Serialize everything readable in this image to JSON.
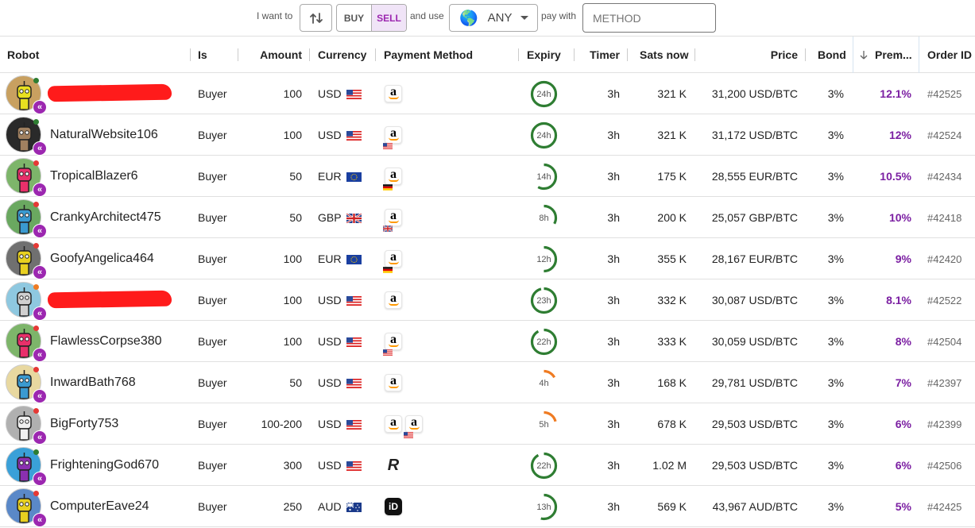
{
  "filter": {
    "i_want_to": "I want to",
    "buy": "BUY",
    "sell": "SELL",
    "and_use": "and use",
    "currency_selected": "ANY",
    "pay_with": "pay with",
    "method_placeholder": "METHOD"
  },
  "columns": {
    "robot": "Robot",
    "is": "Is",
    "amount": "Amount",
    "currency": "Currency",
    "payment_method": "Payment Method",
    "expiry": "Expiry",
    "timer": "Timer",
    "sats_now": "Sats now",
    "price": "Price",
    "bond": "Bond",
    "premium": "Prem...",
    "order_id": "Order ID"
  },
  "sort": {
    "column": "premium",
    "direction": "descending"
  },
  "rows": [
    {
      "nick": "",
      "redacted": true,
      "status": "online",
      "avatar_bg": "#c8a060",
      "avatar_fg": "#e8e020",
      "is": "Buyer",
      "amount": "100",
      "currency": "USD",
      "flag": "us",
      "methods": [
        {
          "icon": "amazon-icon",
          "flag": ""
        }
      ],
      "expiry_label": "24h",
      "expiry_fraction": 1.0,
      "expiry_color": "#2e7d32",
      "timer": "3h",
      "sats": "321 K",
      "price": "31,200 USD/BTC",
      "bond": "3%",
      "premium": "12.1%",
      "order_id": "#42525"
    },
    {
      "nick": "NaturalWebsite106",
      "status": "online",
      "avatar_bg": "#2a2a2a",
      "avatar_fg": "#a08060",
      "is": "Buyer",
      "amount": "100",
      "currency": "USD",
      "flag": "us",
      "methods": [
        {
          "icon": "amazon-icon",
          "flag": "us"
        }
      ],
      "expiry_label": "24h",
      "expiry_fraction": 1.0,
      "expiry_color": "#2e7d32",
      "timer": "3h",
      "sats": "321 K",
      "price": "31,172 USD/BTC",
      "bond": "3%",
      "premium": "12%",
      "order_id": "#42524"
    },
    {
      "nick": "TropicalBlazer6",
      "status": "offline",
      "avatar_bg": "#7db56a",
      "avatar_fg": "#e8306a",
      "is": "Buyer",
      "amount": "50",
      "currency": "EUR",
      "flag": "eu",
      "methods": [
        {
          "icon": "amazon-icon",
          "flag": "de"
        }
      ],
      "expiry_label": "14h",
      "expiry_fraction": 0.58,
      "expiry_color": "#2e7d32",
      "timer": "3h",
      "sats": "175 K",
      "price": "28,555 EUR/BTC",
      "bond": "3%",
      "premium": "10.5%",
      "order_id": "#42434"
    },
    {
      "nick": "CrankyArchitect475",
      "status": "offline",
      "avatar_bg": "#6aa860",
      "avatar_fg": "#3a9ad0",
      "is": "Buyer",
      "amount": "50",
      "currency": "GBP",
      "flag": "gb",
      "methods": [
        {
          "icon": "amazon-icon",
          "flag": "gb"
        }
      ],
      "expiry_label": "8h",
      "expiry_fraction": 0.33,
      "expiry_color": "#2e7d32",
      "timer": "3h",
      "sats": "200 K",
      "price": "25,057 GBP/BTC",
      "bond": "3%",
      "premium": "10%",
      "order_id": "#42418"
    },
    {
      "nick": "GoofyAngelica464",
      "status": "offline",
      "avatar_bg": "#707070",
      "avatar_fg": "#e8d020",
      "is": "Buyer",
      "amount": "100",
      "currency": "EUR",
      "flag": "eu",
      "methods": [
        {
          "icon": "amazon-icon",
          "flag": "de"
        }
      ],
      "expiry_label": "12h",
      "expiry_fraction": 0.5,
      "expiry_color": "#2e7d32",
      "timer": "3h",
      "sats": "355 K",
      "price": "28,167 EUR/BTC",
      "bond": "3%",
      "premium": "9%",
      "order_id": "#42420"
    },
    {
      "nick": "",
      "redacted": true,
      "status": "away",
      "avatar_bg": "#8ec8e0",
      "avatar_fg": "#d0d0d0",
      "is": "Buyer",
      "amount": "100",
      "currency": "USD",
      "flag": "us",
      "methods": [
        {
          "icon": "amazon-icon",
          "flag": ""
        }
      ],
      "expiry_label": "23h",
      "expiry_fraction": 0.96,
      "expiry_color": "#2e7d32",
      "timer": "3h",
      "sats": "332 K",
      "price": "30,087 USD/BTC",
      "bond": "3%",
      "premium": "8.1%",
      "order_id": "#42522"
    },
    {
      "nick": "FlawlessCorpse380",
      "status": "offline",
      "avatar_bg": "#7db56a",
      "avatar_fg": "#e8306a",
      "is": "Buyer",
      "amount": "100",
      "currency": "USD",
      "flag": "us",
      "methods": [
        {
          "icon": "amazon-icon",
          "flag": "us"
        }
      ],
      "expiry_label": "22h",
      "expiry_fraction": 0.92,
      "expiry_color": "#2e7d32",
      "timer": "3h",
      "sats": "333 K",
      "price": "30,059 USD/BTC",
      "bond": "3%",
      "premium": "8%",
      "order_id": "#42504"
    },
    {
      "nick": "InwardBath768",
      "status": "offline",
      "avatar_bg": "#e8d8a0",
      "avatar_fg": "#3a9ad0",
      "is": "Buyer",
      "amount": "50",
      "currency": "USD",
      "flag": "us",
      "methods": [
        {
          "icon": "amazon-icon",
          "flag": ""
        }
      ],
      "expiry_label": "4h",
      "expiry_fraction": 0.17,
      "expiry_color": "#ef7b22",
      "timer": "3h",
      "sats": "168 K",
      "price": "29,781 USD/BTC",
      "bond": "3%",
      "premium": "7%",
      "order_id": "#42397"
    },
    {
      "nick": "BigForty753",
      "status": "offline",
      "avatar_bg": "#b0b0b0",
      "avatar_fg": "#f0f0f0",
      "is": "Buyer",
      "amount": "100-200",
      "currency": "USD",
      "flag": "us",
      "methods": [
        {
          "icon": "amazon-icon",
          "flag": ""
        },
        {
          "icon": "amazon-icon",
          "flag": "us"
        }
      ],
      "expiry_label": "5h",
      "expiry_fraction": 0.21,
      "expiry_color": "#ef7b22",
      "timer": "3h",
      "sats": "678 K",
      "price": "29,503 USD/BTC",
      "bond": "3%",
      "premium": "6%",
      "order_id": "#42399"
    },
    {
      "nick": "FrighteningGod670",
      "status": "online",
      "avatar_bg": "#3aa0d8",
      "avatar_fg": "#8a30b0",
      "is": "Buyer",
      "amount": "300",
      "currency": "USD",
      "flag": "us",
      "methods": [
        {
          "icon": "revolut-icon",
          "flag": ""
        }
      ],
      "expiry_label": "22h",
      "expiry_fraction": 0.92,
      "expiry_color": "#2e7d32",
      "timer": "3h",
      "sats": "1.02 M",
      "price": "29,503 USD/BTC",
      "bond": "3%",
      "premium": "6%",
      "order_id": "#42506"
    },
    {
      "nick": "ComputerEave24",
      "status": "offline",
      "avatar_bg": "#5a88c8",
      "avatar_fg": "#e8d020",
      "is": "Buyer",
      "amount": "250",
      "currency": "AUD",
      "flag": "au",
      "methods": [
        {
          "icon": "payid-icon",
          "flag": ""
        }
      ],
      "expiry_label": "13h",
      "expiry_fraction": 0.54,
      "expiry_color": "#2e7d32",
      "timer": "3h",
      "sats": "569 K",
      "price": "43,967 AUD/BTC",
      "bond": "3%",
      "premium": "5%",
      "order_id": "#42425"
    }
  ]
}
